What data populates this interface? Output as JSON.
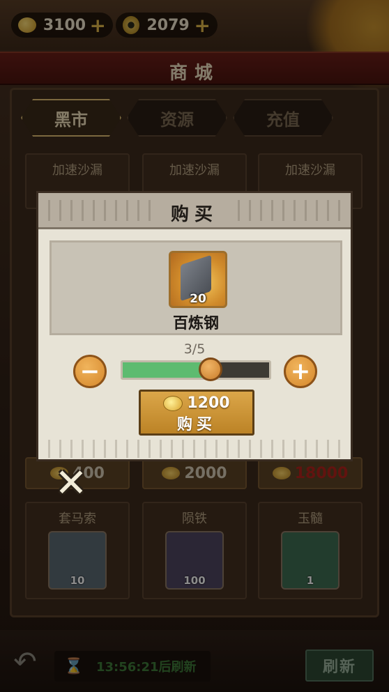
{
  "currencies": [
    {
      "name": "gold-ingot",
      "value": "3100",
      "plus": "+"
    },
    {
      "name": "copper-coin",
      "value": "2079",
      "plus": "+"
    }
  ],
  "page_title": "商城",
  "tabs": [
    {
      "label": "黑市",
      "active": true
    },
    {
      "label": "资源",
      "active": false
    },
    {
      "label": "充值",
      "active": false
    }
  ],
  "shop_row1": [
    {
      "name": "加速沙漏"
    },
    {
      "name": "加速沙漏"
    },
    {
      "name": "加速沙漏"
    }
  ],
  "shop_prices_row": [
    {
      "price": "400",
      "color": "#d8cdb6"
    },
    {
      "price": "2000",
      "color": "#d8cdb6"
    },
    {
      "price": "18000",
      "color": "#b3231c"
    }
  ],
  "shop_row3": [
    {
      "name": "套马索",
      "qty": "10",
      "icon": "rope-icon"
    },
    {
      "name": "陨铁",
      "qty": "100",
      "icon": "meteor-iron-icon"
    },
    {
      "name": "玉髓",
      "qty": "1",
      "icon": "jade-crystal-icon"
    }
  ],
  "footer": {
    "back_icon": "back-arrow-icon",
    "timer_text": "13:56:21后刷新",
    "refresh_label": "刷新"
  },
  "modal": {
    "title": "购买",
    "item": {
      "name": "百炼钢",
      "qty": "20",
      "icon": "steel-ingot-icon"
    },
    "count_text": "3/5",
    "minus": "−",
    "plus": "+",
    "slider": {
      "value": 3,
      "max": 5
    },
    "buy_price": "1200",
    "buy_label": "购买",
    "close_icon": "close-x-icon",
    "close_glyph": "✕"
  }
}
